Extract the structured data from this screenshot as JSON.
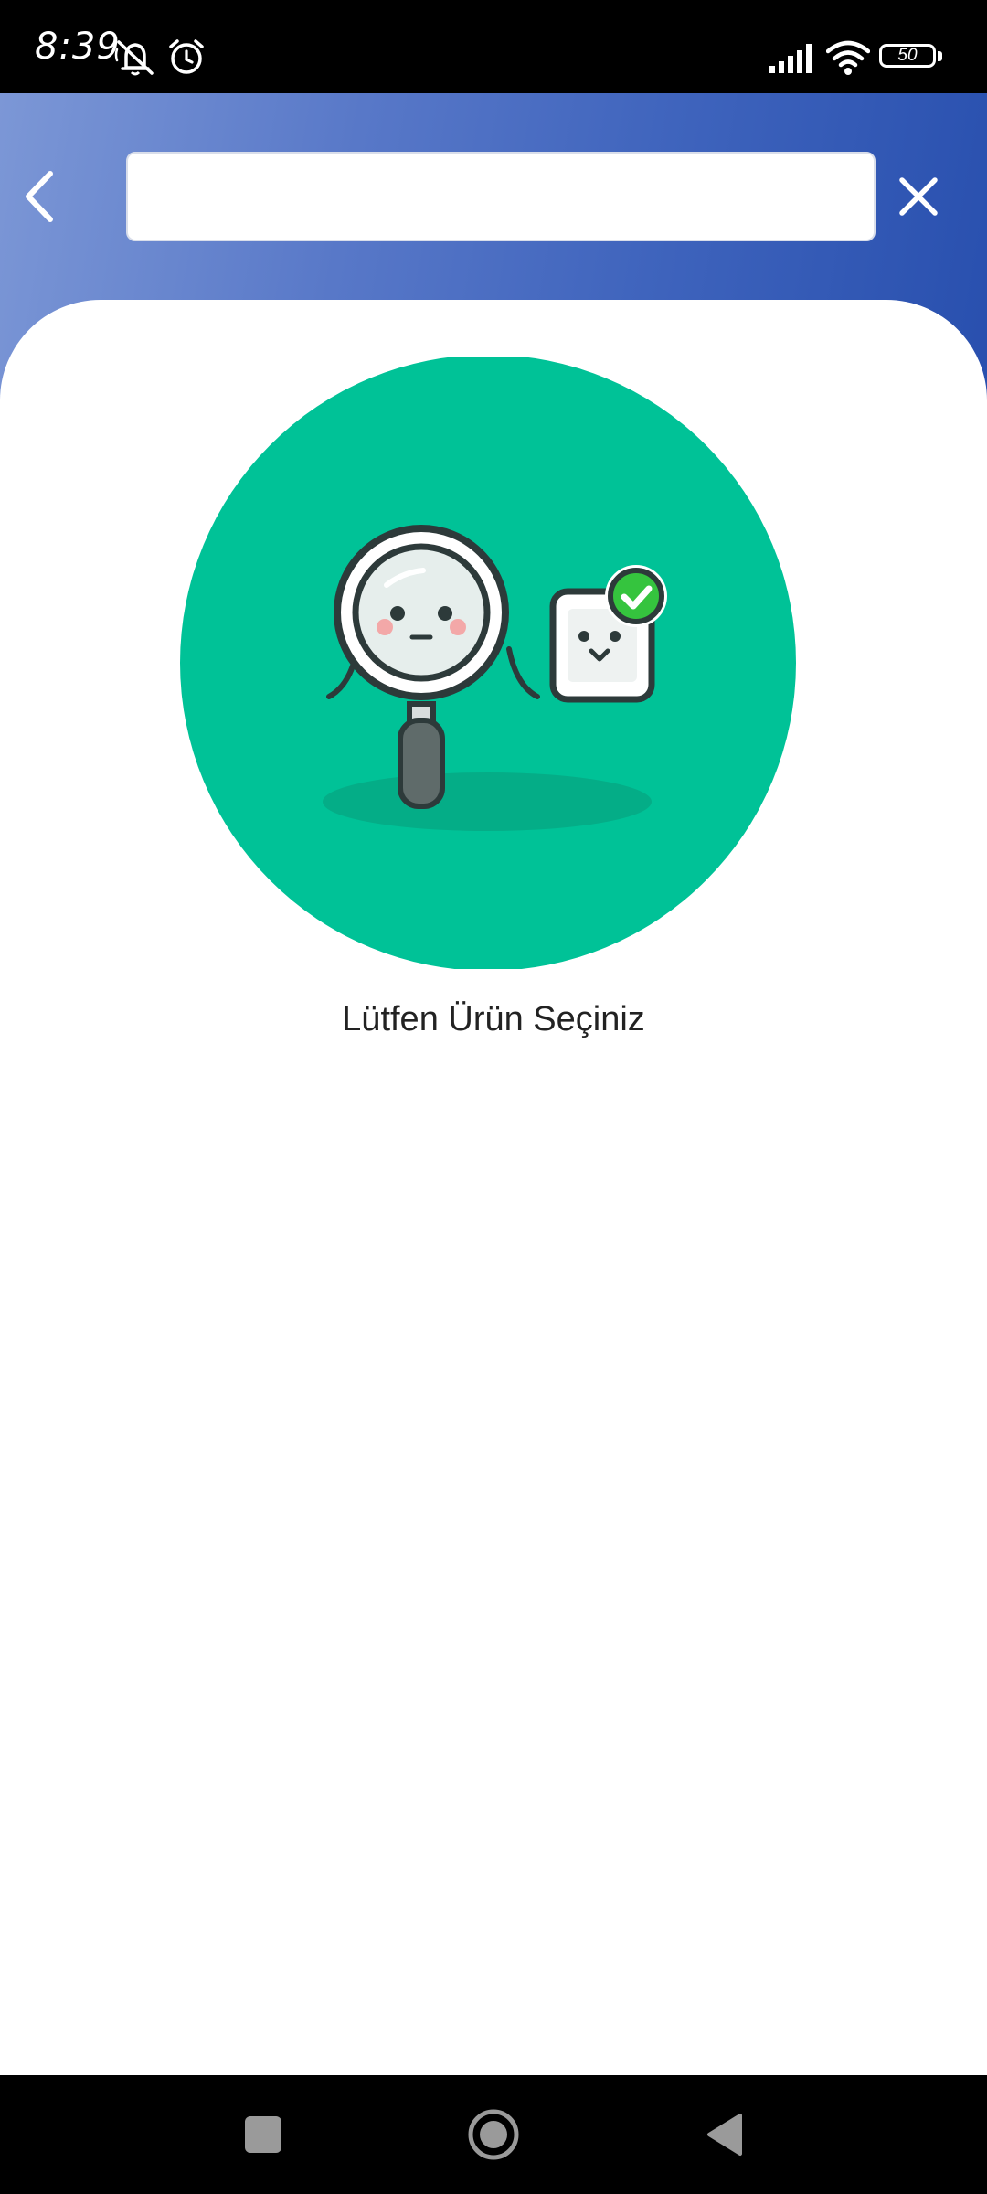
{
  "status_bar": {
    "time": "8:39",
    "battery_level": "50",
    "icons": [
      "muted-notifications-icon",
      "alarm-icon",
      "signal-icon",
      "wifi-icon",
      "battery-icon"
    ]
  },
  "header": {
    "back_icon": "chevron-left-icon",
    "search": {
      "value": "",
      "placeholder": ""
    },
    "close_icon": "close-icon",
    "gradient_colors": [
      "#7c97d6",
      "#284fae"
    ]
  },
  "empty_state": {
    "illustration": "magnifier-and-product-check-illustration",
    "message": "Lütfen Ürün Seçiniz",
    "accent_color": "#00c297"
  },
  "nav_bar": {
    "buttons": [
      "recents-square-icon",
      "home-circle-icon",
      "back-triangle-icon"
    ]
  }
}
